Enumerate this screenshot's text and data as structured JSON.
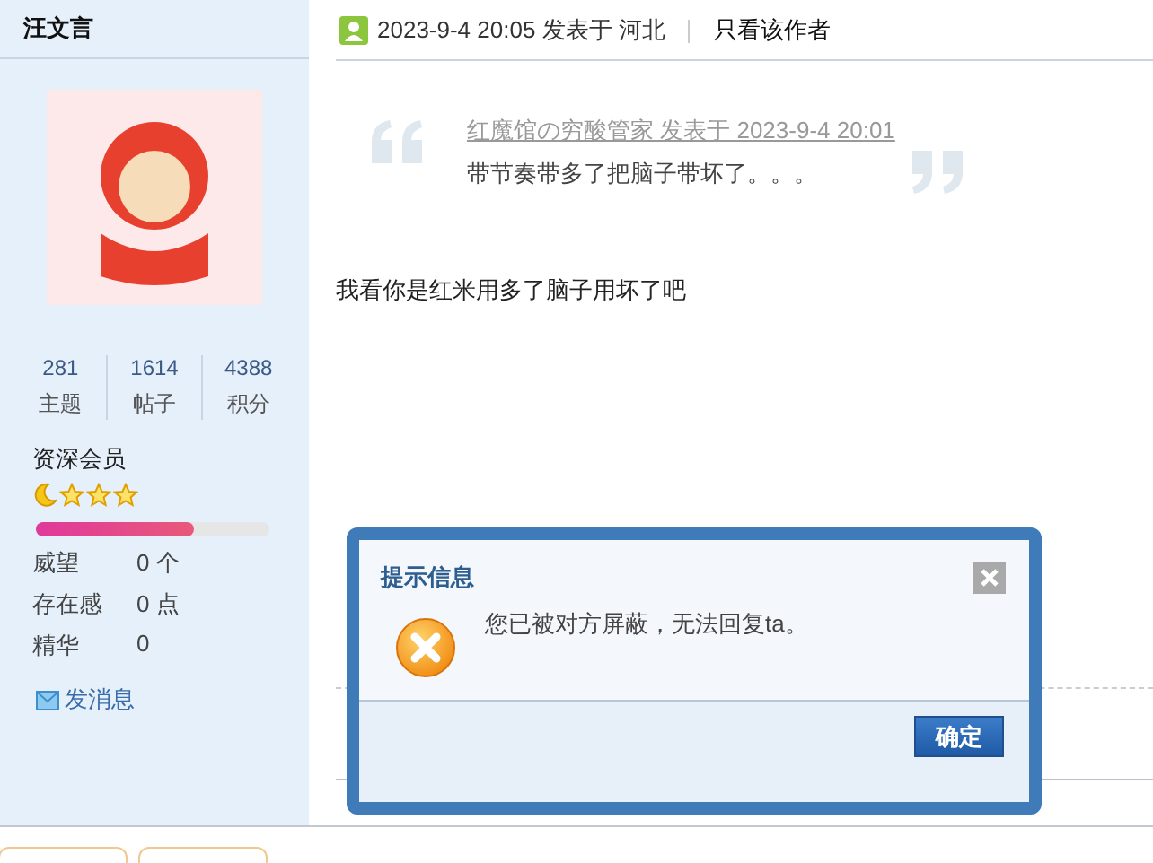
{
  "author": {
    "name": "汪文言",
    "stats": [
      {
        "value": "281",
        "label": "主题"
      },
      {
        "value": "1614",
        "label": "帖子"
      },
      {
        "value": "4388",
        "label": "积分"
      }
    ],
    "rank": "资深会员",
    "rank_icons": [
      {
        "kind": "moon"
      },
      {
        "kind": "star"
      },
      {
        "kind": "star"
      },
      {
        "kind": "star"
      }
    ],
    "progress": {
      "level": 0.68
    },
    "fields": [
      {
        "label": "威望",
        "value": "0 个"
      },
      {
        "label": "存在感",
        "value": "0 点"
      },
      {
        "label": "精华",
        "value": "0"
      }
    ],
    "message_link": "发消息"
  },
  "post": {
    "time": "2023-9-4 20:05 发表于 河北",
    "author_only": "只看该作者",
    "quote": {
      "source": "红魔馆の穷酸管家 发表于 2023-9-4 20:01",
      "text": "带节奏带多了把脑子带坏了。。。"
    },
    "body": "我看你是红米用多了脑子用坏了吧"
  },
  "dialog": {
    "title": "提示信息",
    "message": "您已被对方屏蔽，无法回复ta。",
    "kind": "error",
    "button": "确定"
  }
}
